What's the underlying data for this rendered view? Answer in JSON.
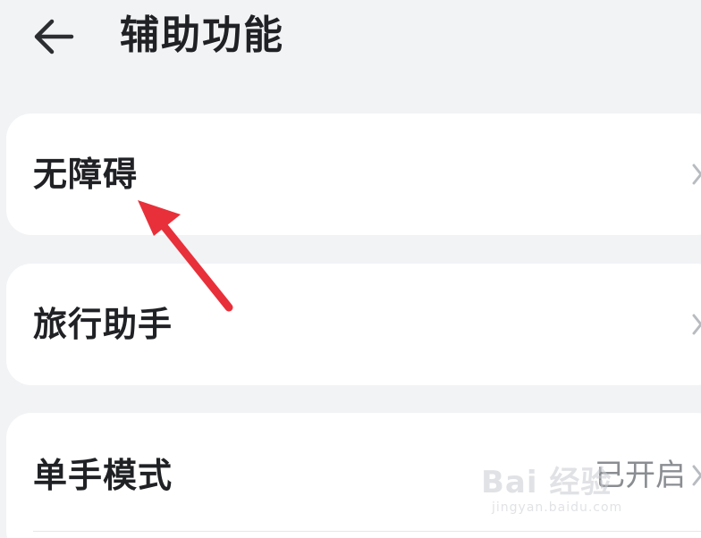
{
  "header": {
    "title": "辅助功能",
    "back_icon": "back-arrow-icon"
  },
  "settings": [
    {
      "label": "无障碍",
      "value": "",
      "icon": "chevron-right-icon"
    },
    {
      "label": "旅行助手",
      "value": "",
      "icon": "chevron-right-icon"
    },
    {
      "label": "单手模式",
      "value": "已开启",
      "icon": "chevron-right-icon"
    }
  ],
  "annotation": {
    "arrow_color": "#e8303a",
    "points_to": "无障碍"
  },
  "watermark": {
    "main": "Bai 经验",
    "sub": "jingyan.baidu.com"
  },
  "colors": {
    "background": "#f1f3f5",
    "card": "#ffffff",
    "text_primary": "#202124",
    "text_secondary": "#8a8d91",
    "annotation": "#e8303a"
  }
}
